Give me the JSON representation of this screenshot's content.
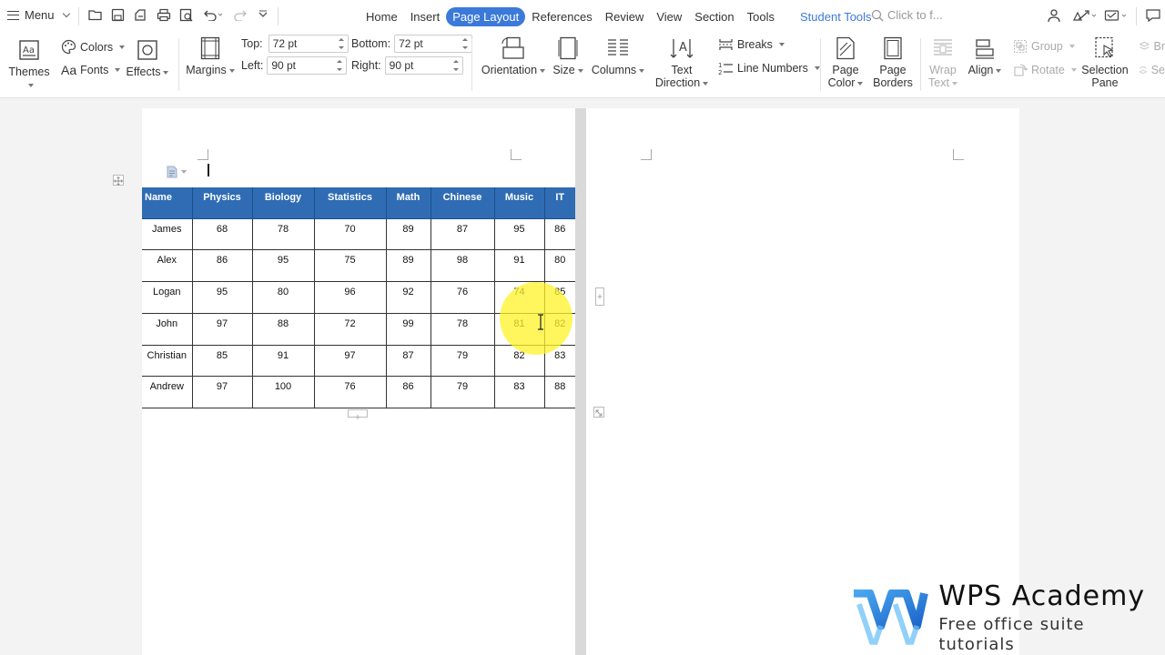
{
  "menu": {
    "label": "Menu"
  },
  "tabs": [
    {
      "label": "Home"
    },
    {
      "label": "Insert"
    },
    {
      "label": "Page Layout"
    },
    {
      "label": "References"
    },
    {
      "label": "Review"
    },
    {
      "label": "View"
    },
    {
      "label": "Section"
    },
    {
      "label": "Tools"
    },
    {
      "label": "Student Tools"
    }
  ],
  "active_tab": "Page Layout",
  "search": {
    "placeholder": "Click to f..."
  },
  "ribbon": {
    "themes": "Themes",
    "colors": "Colors",
    "fonts": "Fonts",
    "effects": "Effects",
    "margins": "Margins",
    "top_label": "Top:",
    "top_value": "72 pt",
    "bottom_label": "Bottom:",
    "bottom_value": "72 pt",
    "left_label": "Left:",
    "left_value": "90 pt",
    "right_label": "Right:",
    "right_value": "90 pt",
    "orientation": "Orientation",
    "size": "Size",
    "columns": "Columns",
    "text_direction_1": "Text",
    "text_direction_2": "Direction",
    "breaks": "Breaks",
    "line_numbers": "Line Numbers",
    "page_color_1": "Page",
    "page_color_2": "Color",
    "page_borders_1": "Page",
    "page_borders_2": "Borders",
    "wrap_text_1": "Wrap",
    "wrap_text_2": "Text",
    "align": "Align",
    "group": "Group",
    "rotate": "Rotate",
    "selection_pane_1": "Selection",
    "selection_pane_2": "Pane",
    "cut_1": "Br",
    "cut_2": "Se"
  },
  "table": {
    "headers": [
      "Name",
      "Physics",
      "Biology",
      "Statistics",
      "Math",
      "Chinese",
      "Music",
      "IT"
    ],
    "rows": [
      [
        "James",
        "68",
        "78",
        "70",
        "89",
        "87",
        "95",
        "86"
      ],
      [
        "Alex",
        "86",
        "95",
        "75",
        "89",
        "98",
        "91",
        "80"
      ],
      [
        "Logan",
        "95",
        "80",
        "96",
        "92",
        "76",
        "74",
        "85"
      ],
      [
        "John",
        "97",
        "88",
        "72",
        "99",
        "78",
        "81",
        "82"
      ],
      [
        "Christian",
        "85",
        "91",
        "97",
        "87",
        "79",
        "82",
        "83"
      ],
      [
        "Andrew",
        "97",
        "100",
        "76",
        "86",
        "79",
        "83",
        "88"
      ]
    ]
  },
  "watermark": {
    "title": "WPS Academy",
    "subtitle": "Free office suite tutorials"
  },
  "colors": {
    "accent": "#3b7ad9",
    "table_header": "#2f6cb3",
    "highlight": "#fff328"
  }
}
